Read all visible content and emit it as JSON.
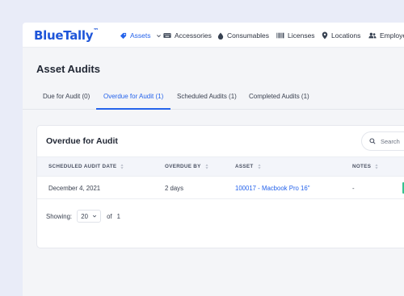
{
  "app": {
    "logo_blue": "BlueTally",
    "logo_tm": "™"
  },
  "nav": {
    "items": [
      {
        "label": "Assets",
        "icon": "tag-icon",
        "active": true
      },
      {
        "label": "Accessories",
        "icon": "keyboard-icon"
      },
      {
        "label": "Consumables",
        "icon": "droplet-icon"
      },
      {
        "label": "Licenses",
        "icon": "barcode-icon"
      },
      {
        "label": "Locations",
        "icon": "map-pin-icon"
      },
      {
        "label": "Employee",
        "icon": "users-icon"
      }
    ]
  },
  "page": {
    "title": "Asset Audits"
  },
  "tabs": [
    {
      "label": "Due for Audit (0)"
    },
    {
      "label": "Overdue for Audit (1)",
      "active": true
    },
    {
      "label": "Scheduled Audits (1)"
    },
    {
      "label": "Completed Audits (1)"
    }
  ],
  "card": {
    "title": "Overdue for Audit",
    "search_placeholder": "Search"
  },
  "table": {
    "columns": [
      "SCHEDULED AUDIT DATE",
      "OVERDUE BY",
      "ASSET",
      "NOTES"
    ],
    "rows": [
      {
        "date": "December 4, 2021",
        "overdue": "2 days",
        "asset": "100017 - Macbook Pro 16\"",
        "notes": "-",
        "status_color": "#34c38f"
      }
    ]
  },
  "footer": {
    "showing_label": "Showing:",
    "per_page": "20",
    "of_label": "of",
    "total_pages": "1"
  },
  "colors": {
    "accent": "#2563eb",
    "brand": "#1f56d9",
    "status": "#34c38f"
  }
}
